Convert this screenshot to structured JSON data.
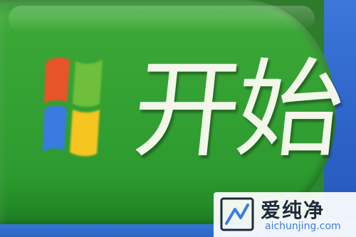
{
  "start_button": {
    "label": "开始",
    "logo_icon": "windows-xp-logo-icon",
    "logo_colors": {
      "red": "#e8542a",
      "green": "#6fbe3c",
      "blue": "#3a7be0",
      "yellow": "#f6c51f"
    },
    "bg_color": "#32a032"
  },
  "taskbar": {
    "color": "#2d63c7"
  },
  "watermark": {
    "title": "爱纯净",
    "url": "aichunjing.com",
    "logo_icon": "aichunjing-logo-icon",
    "accent": "#3b7ddd"
  }
}
